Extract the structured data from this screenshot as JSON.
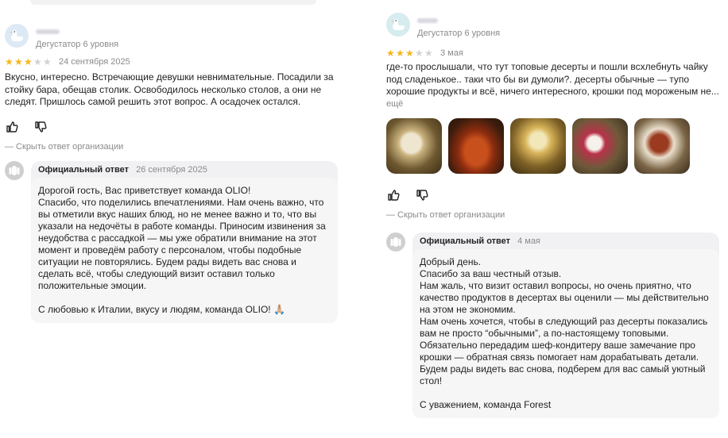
{
  "review_left": {
    "author_level": "Дегустатор 6 уровня",
    "rating": 3,
    "date": "24 сентября 2025",
    "text": "Вкусно, интересно. Встречающие девушки невнимательные. Посадили за стойку бара, обещав столик. Освободилось несколько столов, а они не следят. Пришлось самой решить этот вопрос. А осадочек остался.",
    "hide_answer": "— Скрыть ответ организации",
    "answer": {
      "org_label": "Официальный ответ",
      "date": "26 сентября 2025",
      "text": "Дорогой гость, Вас приветствует команда OLIO!\nСпасибо, что поделились впечатлениями. Нам очень важно, что вы отметили вкус наших блюд, но не менее важно и то, что вы указали на недочёты в работе команды. Приносим извинения за неудобства с рассадкой — мы уже обратили внимание на этот момент и проведём работу с персоналом, чтобы подобные ситуации не повторялись. Будем рады видеть вас снова и сделать всё, чтобы следующий визит оставил только положительные эмоции.",
      "sign": "С любовью к Италии, вкусу и людям, команда OLIO! 🙏🏼"
    }
  },
  "review_right": {
    "author_level": "Дегустатор 6 уровня",
    "rating": 3,
    "date": "3 мая",
    "text": "где-то прослышали, что тут топовые десерты и пошли всхлебнуть чайку под сладенькое.. таки что бы ви думоли?. десерты обычные — тупо хорошие продукты и всё, ничего интересного, крошки под мороженым не...",
    "more": "ещё",
    "photos": [
      "dessert-photo-1",
      "tea-teapot-photo",
      "dessert-photo-2",
      "dessert-photo-3",
      "dessert-photo-4"
    ],
    "hide_answer": "— Скрыть ответ организации",
    "answer": {
      "org_label": "Официальный ответ",
      "date": "4 мая",
      "text": "Добрый день.\nСпасибо за ваш честный отзыв.\nНам жаль, что визит оставил вопросы, но очень приятно, что качество продуктов в десертах вы оценили — мы действительно на этом не экономим.\nНам очень хочется, чтобы в следующий раз десерты показались вам не просто “обычными”, а по-настоящему топовыми. Обязательно передадим шеф-кондитеру ваше замечание про крошки — обратная связь помогает нам дорабатывать детали. Будем рады видеть вас снова, подберем для вас самый уютный стол!",
      "sign": "С уважением, команда Forest"
    }
  },
  "colors": {
    "star_on": "#f7b619",
    "star_off": "#d2d2d2",
    "muted": "#8a8a8a",
    "answer_bg": "#f1f1f3"
  }
}
